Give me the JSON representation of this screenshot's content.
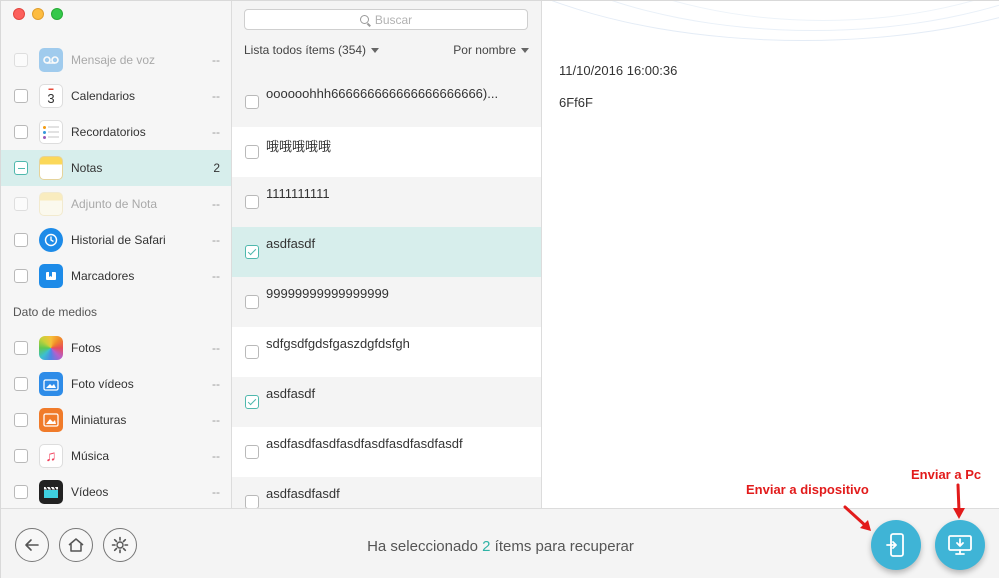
{
  "sidebar": {
    "items": [
      {
        "label": "Mensaje de voz",
        "count": "--"
      },
      {
        "label": "Calendarios",
        "count": "--"
      },
      {
        "label": "Recordatorios",
        "count": "--"
      },
      {
        "label": "Notas",
        "count": "2"
      },
      {
        "label": "Adjunto de Nota",
        "count": "--"
      },
      {
        "label": "Historial de Safari",
        "count": "--"
      },
      {
        "label": "Marcadores",
        "count": "--"
      }
    ],
    "media_header": "Dato de medios",
    "media_items": [
      {
        "label": "Fotos",
        "count": "--"
      },
      {
        "label": "Foto vídeos",
        "count": "--"
      },
      {
        "label": "Miniaturas",
        "count": "--"
      },
      {
        "label": "Música",
        "count": "--"
      },
      {
        "label": "Vídeos",
        "count": "--"
      }
    ],
    "calendar_icon_day": "3"
  },
  "middle": {
    "search_placeholder": "Buscar",
    "list_filter": "Lista todos ítems (354)",
    "sort_label": "Por nombre",
    "rows": [
      {
        "text": "oooooohhh666666666666666666666)...",
        "checked": false
      },
      {
        "text": "哦哦哦哦哦",
        "checked": false
      },
      {
        "text": "1111111111",
        "checked": false
      },
      {
        "text": "asdfasdf",
        "checked": true
      },
      {
        "text": "99999999999999999",
        "checked": false
      },
      {
        "text": "sdfgsdfgdsfgaszdgfdsfgh",
        "checked": false
      },
      {
        "text": "asdfasdf",
        "checked": true
      },
      {
        "text": "asdfasdfasdfasdfasdfasdfasdfasdf",
        "checked": false
      },
      {
        "text": "asdfasdfasdf",
        "checked": false
      }
    ]
  },
  "detail": {
    "date": "11/10/2016 16:00:36",
    "content": "6Ff6F"
  },
  "bottom": {
    "status_prefix": "Ha seleccionado",
    "status_count": "2",
    "status_suffix": "ítems para recuperar",
    "callout_device": "Enviar a dispositivo",
    "callout_pc": "Enviar a Pc"
  },
  "colors": {
    "accent": "#2fb3a6",
    "selection": "#d7eeec",
    "action_button": "#3fb4d6",
    "callout": "#e21b1b"
  }
}
